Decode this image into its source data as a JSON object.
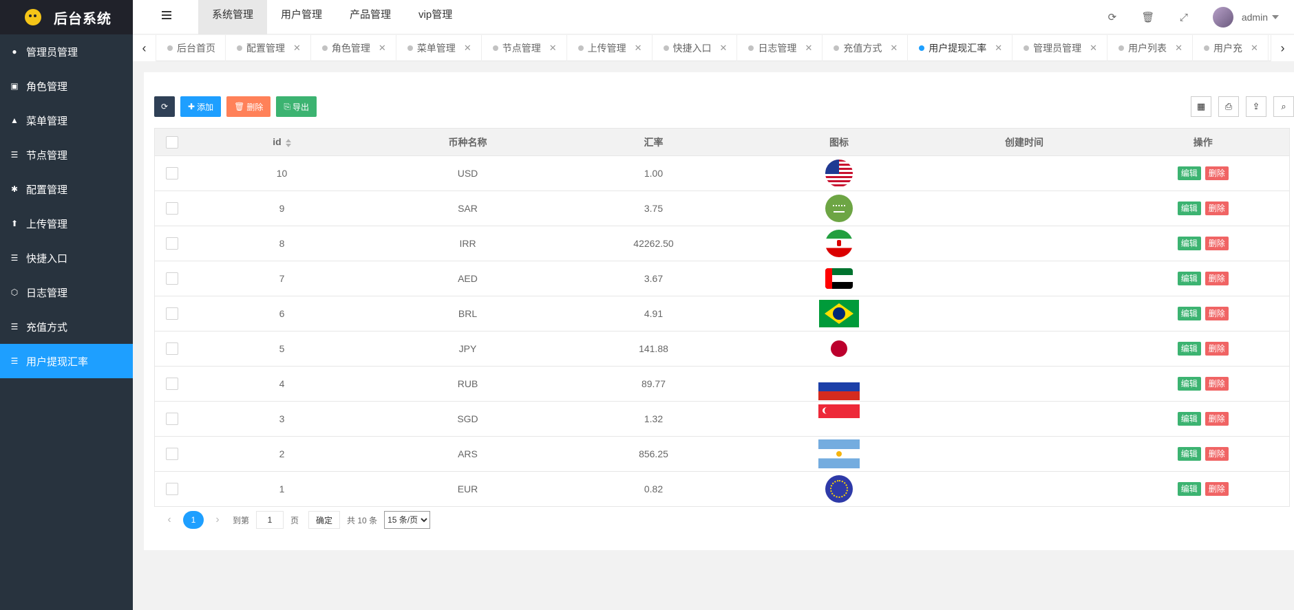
{
  "app": {
    "title": "后台系统"
  },
  "sidebar": {
    "items": [
      {
        "label": "管理员管理",
        "icon": "user-icon"
      },
      {
        "label": "角色管理",
        "icon": "role-icon"
      },
      {
        "label": "菜单管理",
        "icon": "tree-icon"
      },
      {
        "label": "节点管理",
        "icon": "list-icon"
      },
      {
        "label": "配置管理",
        "icon": "gear-icon"
      },
      {
        "label": "上传管理",
        "icon": "upload-icon"
      },
      {
        "label": "快捷入口",
        "icon": "list-icon"
      },
      {
        "label": "日志管理",
        "icon": "log-icon"
      },
      {
        "label": "充值方式",
        "icon": "list-icon"
      },
      {
        "label": "用户提现汇率",
        "icon": "list-icon",
        "active": true
      }
    ]
  },
  "header": {
    "nav": [
      "系统管理",
      "用户管理",
      "产品管理",
      "vip管理"
    ],
    "user": "admin"
  },
  "tabs": [
    "后台首页",
    "配置管理",
    "角色管理",
    "菜单管理",
    "节点管理",
    "上传管理",
    "快捷入口",
    "日志管理",
    "充值方式",
    "用户提现汇率",
    "管理员管理",
    "用户列表",
    "用户充"
  ],
  "toolbar": {
    "add": "添加",
    "delete": "删除",
    "export": "导出"
  },
  "table": {
    "headers": [
      "id",
      "币种名称",
      "汇率",
      "图标",
      "创建时间",
      "操作"
    ],
    "edit_label": "编辑",
    "delete_label": "删除",
    "rows": [
      {
        "id": "10",
        "currency": "USD",
        "rate": "1.00",
        "flag": "usd",
        "created": ""
      },
      {
        "id": "9",
        "currency": "SAR",
        "rate": "3.75",
        "flag": "sar",
        "created": ""
      },
      {
        "id": "8",
        "currency": "IRR",
        "rate": "42262.50",
        "flag": "irr",
        "created": ""
      },
      {
        "id": "7",
        "currency": "AED",
        "rate": "3.67",
        "flag": "aed",
        "created": ""
      },
      {
        "id": "6",
        "currency": "BRL",
        "rate": "4.91",
        "flag": "brl",
        "created": ""
      },
      {
        "id": "5",
        "currency": "JPY",
        "rate": "141.88",
        "flag": "jpy",
        "created": ""
      },
      {
        "id": "4",
        "currency": "RUB",
        "rate": "89.77",
        "flag": "rub",
        "created": ""
      },
      {
        "id": "3",
        "currency": "SGD",
        "rate": "1.32",
        "flag": "sgd",
        "created": ""
      },
      {
        "id": "2",
        "currency": "ARS",
        "rate": "856.25",
        "flag": "ars",
        "created": ""
      },
      {
        "id": "1",
        "currency": "EUR",
        "rate": "0.82",
        "flag": "eur",
        "created": ""
      }
    ]
  },
  "pagination": {
    "current": "1",
    "goto_prefix": "到第",
    "goto_value": "1",
    "goto_suffix": "页",
    "confirm": "确定",
    "total": "共 10 条",
    "page_size": "15 条/页"
  }
}
